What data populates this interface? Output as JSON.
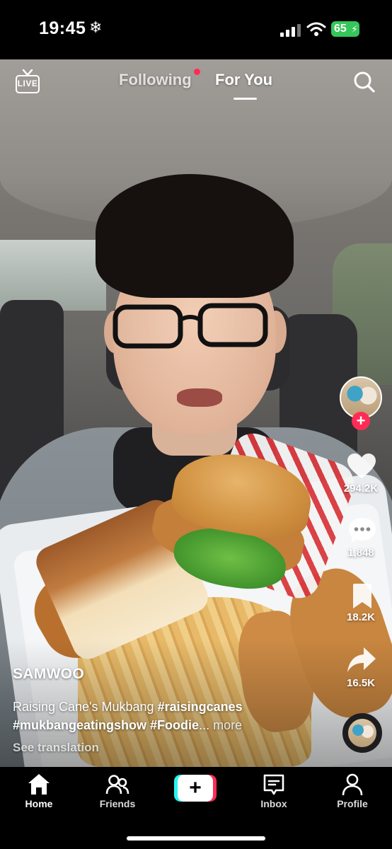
{
  "status_bar": {
    "time": "19:45",
    "snow_glyph": "❄",
    "battery_level": "65",
    "battery_color": "#34c759"
  },
  "top_nav": {
    "live_label": "LIVE",
    "following_label": "Following",
    "for_you_label": "For You",
    "active_tab": "For You",
    "notification_dot_color": "#fe2c55"
  },
  "actions": {
    "likes": "294.2K",
    "comments": "1,848",
    "saves": "18.2K",
    "shares": "16.5K",
    "follow_glyph": "+"
  },
  "post": {
    "username": "SAMWOO",
    "caption_text": "Raising Cane's Mukbang ",
    "hashtags": [
      "#raisingcanes",
      "#mukbangeatingshow",
      "#Foodie"
    ],
    "ellipsis": "...",
    "more_label": "more",
    "see_translation": "See translation"
  },
  "tab_bar": {
    "items": [
      {
        "label": "Home",
        "icon": "home-icon",
        "active": true
      },
      {
        "label": "Friends",
        "icon": "friends-icon",
        "active": false
      },
      {
        "label": "",
        "icon": "create-plus-icon",
        "active": false
      },
      {
        "label": "Inbox",
        "icon": "inbox-icon",
        "active": false
      },
      {
        "label": "Profile",
        "icon": "profile-icon",
        "active": false
      }
    ],
    "create_glyph": "+",
    "accent_cyan": "#25f4ee",
    "accent_red": "#fe2c55"
  }
}
